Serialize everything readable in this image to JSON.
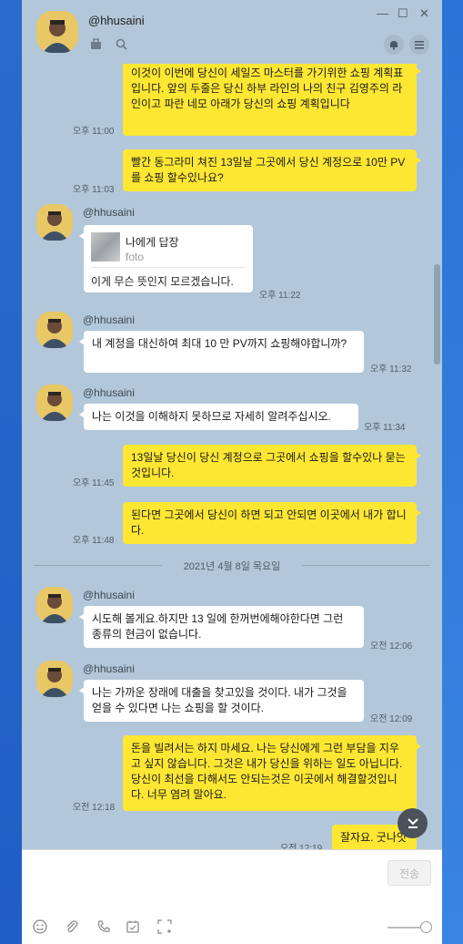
{
  "header": {
    "name": "@hhusaini",
    "window_buttons": {
      "minimize": "—",
      "maximize": "☐",
      "close": "✕"
    }
  },
  "messages": [
    {
      "text": "이것이 이번에 당신이 세일즈 마스터를 가기위한 쇼핑 계획표입니다. 앞의 두줄은 당신 하부 라인의 나의 친구 김영주의 라인이고 파란 네모 아래가 당신의 쇼핑 계획입니다",
      "time": "오후 11:00"
    },
    {
      "text": "빨간 동그라미 쳐진 13일날 그곳에서 당신 계정으로 10만 PV를 쇼핑 할수있나요?",
      "time": "오후 11:03"
    },
    {
      "sender": "@hhusaini",
      "reply_title": "나에게 답장",
      "reply_sub": "foto",
      "text": "이게 무슨 뜻인지 모르겠습니다.",
      "time": "오후 11:22"
    },
    {
      "sender": "@hhusaini",
      "text": "내 계정을 대신하여 최대 10 만 PV까지 쇼핑해야합니까?",
      "time": "오후 11:32"
    },
    {
      "sender": "@hhusaini",
      "text": "나는 이것을 이해하지 못하므로 자세히 알려주십시오.",
      "time": "오후 11:34"
    },
    {
      "text": "13일날 당신이 당신 계정으로 그곳에서 쇼핑을 할수있나 묻는것입니다.",
      "time": "오후 11:45"
    },
    {
      "text": "된다면 그곳에서 당신이 하면 되고 안되면 이곳에서 내가 합니다.",
      "time": "오후 11:48"
    },
    {
      "sender": "@hhusaini",
      "text": "시도해 볼게요.하지만 13 일에 한꺼번에해야한다면 그런 종류의 현금이 없습니다.",
      "time": "오전 12:06"
    },
    {
      "sender": "@hhusaini",
      "text": "나는 가까운 장래에 대출을 찾고있을 것이다. 내가 그것을 얻을 수 있다면 나는 쇼핑을 할 것이다.",
      "time": "오전 12:09"
    },
    {
      "text": "돈을 빌려서는 하지 마세요. 나는 당신에게 그런 부담을 지우고 싶지 않습니다. 그것은 내가 당신을 위하는 일도 아닙니다.  당신이  최선을 다해서도 안되는것은 이곳에서 해결할것입니다. 너무 염려 말아요.",
      "time": "오전 12:18"
    },
    {
      "text": "잘자요. 굿나잇",
      "time": "오전 12:19"
    }
  ],
  "date_separator": "2021년 4월 8일 목요일",
  "input": {
    "send_label": "전송"
  },
  "icons": {
    "bag": "bag-icon",
    "search": "search-icon",
    "bell": "bell-icon",
    "menu": "menu-icon",
    "emoji": "emoji-icon",
    "attach": "paperclip-icon",
    "call": "phone-icon",
    "schedule": "calendar-icon",
    "capture": "capture-icon",
    "scroll_down": "chevron-down-icon"
  },
  "colors": {
    "chat_bg": "#b2c7d9",
    "my_bubble": "#fee733",
    "their_bubble": "#ffffff"
  }
}
